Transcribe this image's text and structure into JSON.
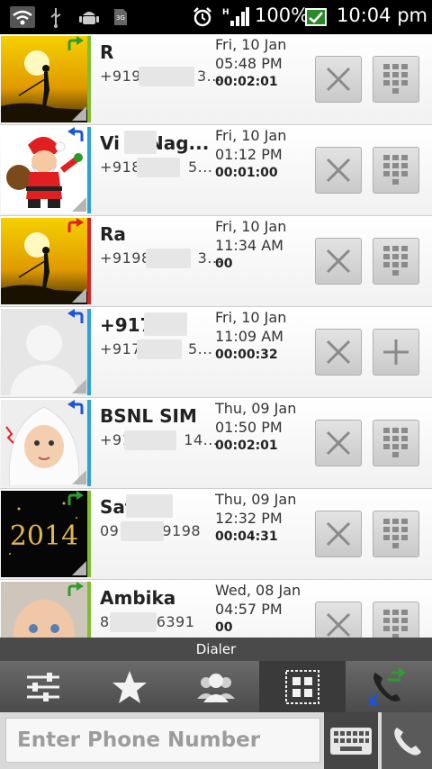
{
  "status_bar": {
    "battery": "100%",
    "time": "10:04 pm",
    "network_label": "H",
    "sim_label": "3G",
    "icons": [
      "wifi-icon",
      "usb-icon",
      "android-icon",
      "sim-icon",
      "alarm-icon",
      "signal-icon",
      "battery-icon"
    ]
  },
  "calls": [
    {
      "name": "R",
      "number": "+919",
      "number_end": "3...",
      "date": "Fri, 10 Jan",
      "time": "05:48 PM",
      "duration": "00:02:01",
      "direction": "outgoing",
      "direction_color": "#2e9d2e",
      "stripe_color": "#7fbf2e",
      "photo": "sunset-fisherman",
      "action": "dialpad"
    },
    {
      "name": "Vi",
      "name_end": "Nag...",
      "number": "+918",
      "number_end": "5...",
      "date": "Fri, 10 Jan",
      "time": "01:12 PM",
      "duration": "00:01:00",
      "direction": "incoming",
      "direction_color": "#1a56d6",
      "stripe_color": "#2aa3d8",
      "photo": "santa",
      "action": "dialpad"
    },
    {
      "name": "Ra",
      "number": "+9198",
      "number_end": "3...",
      "date": "Fri, 10 Jan",
      "time": "11:34 AM",
      "duration": "00",
      "direction": "missed",
      "direction_color": "#e02020",
      "stripe_color": "#e02020",
      "photo": "sunset-fisherman",
      "action": "dialpad"
    },
    {
      "name": "+917",
      "number": "+917",
      "number_end": "5...",
      "date": "Fri, 10 Jan",
      "time": "11:09 AM",
      "duration": "00:00:32",
      "direction": "incoming",
      "direction_color": "#1a56d6",
      "stripe_color": "#2aa3d8",
      "photo": "default-contact",
      "action": "add"
    },
    {
      "name": "BSNL SIM",
      "number": "+91",
      "number_end": "14...",
      "date": "Thu, 09 Jan",
      "time": "01:50 PM",
      "duration": "00:02:01",
      "direction": "incoming",
      "direction_color": "#1a56d6",
      "stripe_color": "#2aa3d8",
      "photo": "baby-white-blanket",
      "action": "dialpad"
    },
    {
      "name": "Sat",
      "number": "09",
      "number_end": "9198",
      "date": "Thu, 09 Jan",
      "time": "12:32 PM",
      "duration": "00:04:31",
      "direction": "outgoing",
      "direction_color": "#2e9d2e",
      "stripe_color": "#7fbf2e",
      "photo": "2014-card",
      "photo_text": "2014",
      "action": "dialpad"
    },
    {
      "name": "Ambika",
      "number": "8",
      "number_end": "6391",
      "date": "Wed, 08 Jan",
      "time": "04:57 PM",
      "duration": "00",
      "direction": "outgoing",
      "direction_color": "#2e9d2e",
      "stripe_color": "#7fbf2e",
      "photo": "baby-face",
      "action": "dialpad"
    }
  ],
  "dialer": {
    "title": "Dialer",
    "tabs": [
      {
        "name": "settings",
        "icon": "sliders-icon"
      },
      {
        "name": "favorites",
        "icon": "star-icon"
      },
      {
        "name": "contacts",
        "icon": "people-icon"
      },
      {
        "name": "groups",
        "icon": "grid-icon",
        "selected": true
      },
      {
        "name": "call-log",
        "icon": "call-log-icon"
      }
    ],
    "input_placeholder": "Enter Phone Number",
    "keyboard_icon": "keyboard-icon",
    "call_icon": "phone-icon"
  }
}
